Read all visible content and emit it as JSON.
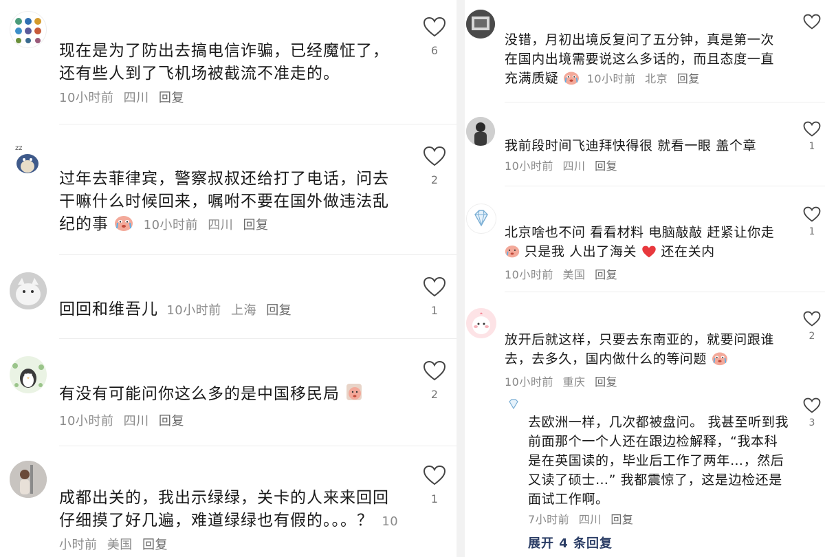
{
  "left": {
    "comments": [
      {
        "text": "现在是为了防出去搞电信诈骗，已经魔怔了，还有些人到了飞机场被截流不准走的。",
        "time": "10小时前",
        "location": "四川",
        "reply": "回复",
        "likes": "6"
      },
      {
        "text": "过年去菲律宾，警察叔叔还给打了电话，问去干嘛什么时候回来，嘱咐不要在国外做违法乱纪的事",
        "time": "10小时前",
        "location": "四川",
        "reply": "回复",
        "likes": "2"
      },
      {
        "text": "回回和维吾儿",
        "time": "10小时前",
        "location": "上海",
        "reply": "回复",
        "likes": "1"
      },
      {
        "text": "有没有可能问你这么多的是中国移民局",
        "time": "10小时前",
        "location": "四川",
        "reply": "回复",
        "likes": "2"
      },
      {
        "text": "成都出关的，我出示绿绿，关卡的人来来回回仔细摸了好几遍，难道绿绿也有假的。。。？",
        "time": "10小时前",
        "location": "美国",
        "reply": "回复",
        "likes": "1"
      }
    ]
  },
  "right": {
    "comments": [
      {
        "text": "没错，月初出境反复问了五分钟，真是第一次在国内出境需要说这么多话的，而且态度一直充满质疑",
        "time": "10小时前",
        "location": "北京",
        "reply": "回复",
        "likes": ""
      },
      {
        "text": "我前段时间飞迪拜快得很 就看一眼 盖个章",
        "time": "10小时前",
        "location": "四川",
        "reply": "回复",
        "likes": "1"
      },
      {
        "text_a": "北京啥也不问 看看材料 电脑敲敲 赶紧让你走",
        "text_b": " 只是我 人出了海关 ",
        "text_c": "还在关内",
        "time": "10小时前",
        "location": "美国",
        "reply": "回复",
        "likes": "1"
      },
      {
        "text": "放开后就这样，只要去东南亚的，就要问跟谁去，去多久，国内做什么的等问题",
        "time": "10小时前",
        "location": "重庆",
        "reply": "回复",
        "likes": "2"
      }
    ],
    "reply": {
      "text": "去欧洲一样，几次都被盘问。 我甚至听到我前面那个一个人还在跟边检解释，“我本科是在英国读的，毕业后工作了两年…，然后又读了硕士…” 我都震惊了，这是边检还是面试工作啊。",
      "time": "7小时前",
      "location": "四川",
      "reply": "回复",
      "likes": "3"
    },
    "expand_label": "展开 4 条回复"
  },
  "colors": {
    "heart_outline": "#444444",
    "meta_gray": "#8a8a8a",
    "expand_blue": "#2c3e66",
    "heart_red": "#e8383d"
  },
  "icons": {
    "like": "heart-outline-icon",
    "emoji_crying": "crying-face-emoji",
    "emoji_heart": "red-heart-emoji",
    "diamond": "diamond-icon"
  }
}
